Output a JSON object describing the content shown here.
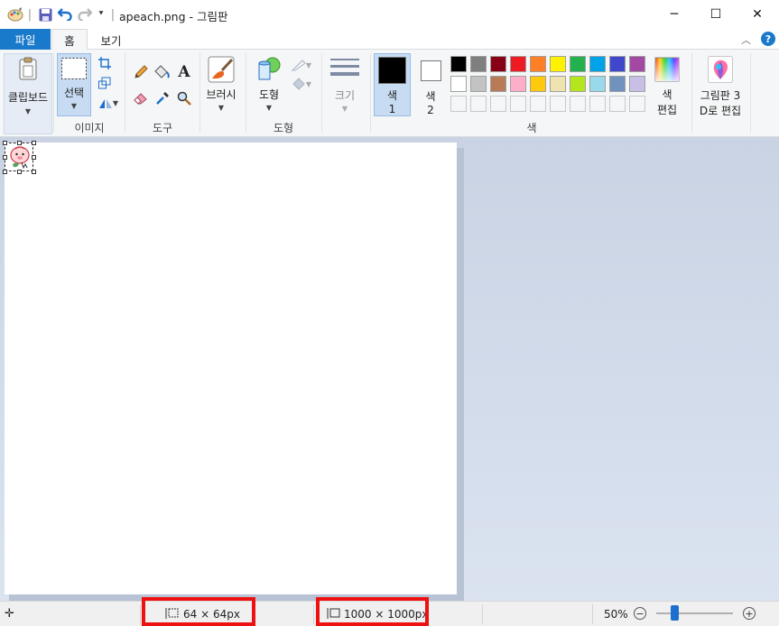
{
  "window": {
    "title": "apeach.png - 그림판",
    "minimize": "─",
    "maximize": "☐",
    "close": "✕"
  },
  "quick_access": {
    "separator": "|",
    "customize": "⯆"
  },
  "tabs": [
    {
      "label": "파일"
    },
    {
      "label": "홈"
    },
    {
      "label": "보기"
    }
  ],
  "help": "?",
  "ribbon": {
    "clipboard": {
      "label": "클립보드"
    },
    "image": {
      "select_label": "선택",
      "group_label": "이미지"
    },
    "tools": {
      "group_label": "도구",
      "text_glyph": "A"
    },
    "brushes": {
      "label": "브러시"
    },
    "shapes": {
      "label": "도형",
      "group_label": "도형"
    },
    "size": {
      "label": "크기"
    },
    "colors": {
      "color1_label": "색",
      "color1_num": "1",
      "color2_label": "색",
      "color2_num": "2",
      "edit_label_1": "색",
      "edit_label_2": "편집",
      "group_label": "색",
      "color1_value": "#000000",
      "color2_value": "#ffffff",
      "palette_row1": [
        "#000000",
        "#7f7f7f",
        "#880015",
        "#ed1c24",
        "#ff7f27",
        "#fff200",
        "#22b14c",
        "#00a2e8",
        "#3f48cc",
        "#a349a4"
      ],
      "palette_row2": [
        "#ffffff",
        "#c3c3c3",
        "#b97a57",
        "#ffaec9",
        "#ffc90e",
        "#efe4b0",
        "#b5e61d",
        "#99d9ea",
        "#7092be",
        "#c8bfe7"
      ]
    },
    "paint3d": {
      "label_1": "그림판 3",
      "label_2": "D로 편집"
    }
  },
  "status": {
    "selection_size": "64 × 64px",
    "image_size": "1000 × 1000px",
    "zoom": "50%",
    "zoom_out": "−",
    "zoom_in": "+"
  },
  "accent_color": "#1979ca",
  "highlight_color": "#ee1111"
}
